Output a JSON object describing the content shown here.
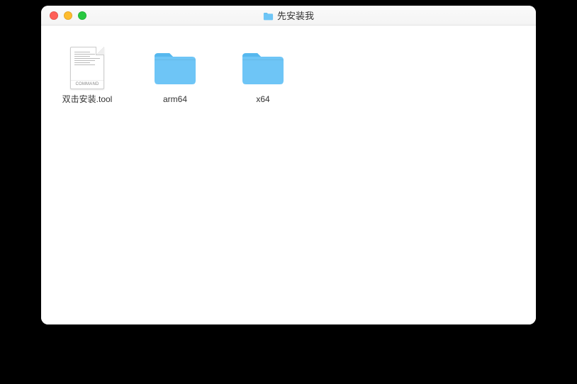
{
  "window": {
    "title": "先安装我"
  },
  "items": [
    {
      "label": "双击安装.tool",
      "type": "command",
      "badge": "COMMAND"
    },
    {
      "label": "arm64",
      "type": "folder"
    },
    {
      "label": "x64",
      "type": "folder"
    }
  ],
  "colors": {
    "folder": "#6ec5f6",
    "folder_tab": "#56b8ee"
  }
}
